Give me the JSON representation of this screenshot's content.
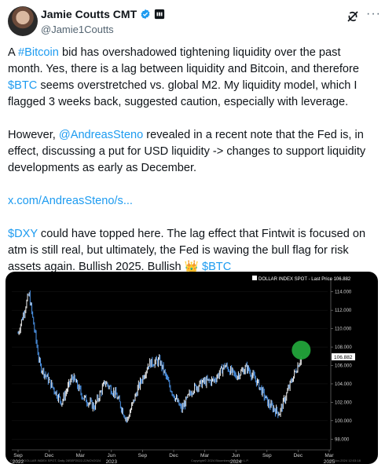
{
  "author": {
    "name": "Jamie Coutts CMT",
    "handle": "@Jamie1Coutts"
  },
  "tweet": {
    "p1_a": "A ",
    "p1_tag": "#Bitcoin",
    "p1_b": " bid has overshadowed tightening liquidity over the past month. Yes, there is a lag between liquidity and Bitcoin, and therefore ",
    "p1_tag2": "$BTC",
    "p1_c": " seems overstretched vs. global M2. My liquidity model, which I flagged 3 weeks back, suggested caution, especially with leverage.",
    "p2_a": "However, ",
    "p2_mention": "@AndreasSteno",
    "p2_b": " revealed in a recent note that the Fed is, in effect, discussing a put for USD liquidity -> changes to support liquidity developments as early as December.",
    "link": "x.com/AndreasSteno/s...",
    "p4_tag": "$DXY",
    "p4_a": " could have topped here. The lag effect that Fintwit is focused on atm is still real, but ultimately, the Fed is waving the bull flag for risk assets again. Bullish 2025. Bullish ",
    "p4_emoji": "👑",
    "p4_tag2": "$BTC"
  },
  "chart_data": {
    "type": "line",
    "title": "DOLLAR INDEX SPOT - Last Price 106.882",
    "last_price_label": "106.882",
    "ylim": [
      97,
      115
    ],
    "y_ticks": [
      98.0,
      100.0,
      102.0,
      104.0,
      106.0,
      108.0,
      110.0,
      112.0,
      114.0
    ],
    "y_tick_labels": [
      "98.000",
      "100.000",
      "102.000",
      "104.000",
      "106.000",
      "108.000",
      "110.000",
      "112.000",
      "114.000"
    ],
    "x_ticks": [
      "Sep",
      "Dec",
      "Mar",
      "Jun",
      "Sep",
      "Dec",
      "Mar",
      "Jun",
      "Sep",
      "Dec",
      "Mar"
    ],
    "x_years": [
      "2022",
      "2023",
      "2024",
      "2025"
    ],
    "x": [
      "2022-09",
      "2022-10",
      "2022-11",
      "2022-12",
      "2023-01",
      "2023-02",
      "2023-03",
      "2023-04",
      "2023-05",
      "2023-06",
      "2023-07",
      "2023-08",
      "2023-09",
      "2023-10",
      "2023-11",
      "2023-12",
      "2024-01",
      "2024-02",
      "2024-03",
      "2024-04",
      "2024-05",
      "2024-06",
      "2024-07",
      "2024-08",
      "2024-09",
      "2024-10",
      "2024-11"
    ],
    "values": [
      109.5,
      113.8,
      106.0,
      104.0,
      102.0,
      104.8,
      102.5,
      101.5,
      104.2,
      102.8,
      100.0,
      103.5,
      106.2,
      106.5,
      103.5,
      101.2,
      103.4,
      104.2,
      104.4,
      106.0,
      104.8,
      105.8,
      104.1,
      101.8,
      100.8,
      104.0,
      106.9
    ],
    "highlight": {
      "label": "106.882",
      "color": "#22a33a"
    },
    "footer_left": "Currency DOLLAR INDEX SPOT, Daily 28SEP2022-22NOV2024",
    "footer_mid": "Copyright© 2024 Bloomberg Finance L.P.",
    "footer_right": "27-Nov-2024 12:03:18"
  },
  "colors": {
    "link": "#1d9bf0",
    "verified": "#1d9bf0",
    "chart_bg": "#000000",
    "candle_up": "#e8e8e8",
    "candle_down": "#4a90e2"
  }
}
